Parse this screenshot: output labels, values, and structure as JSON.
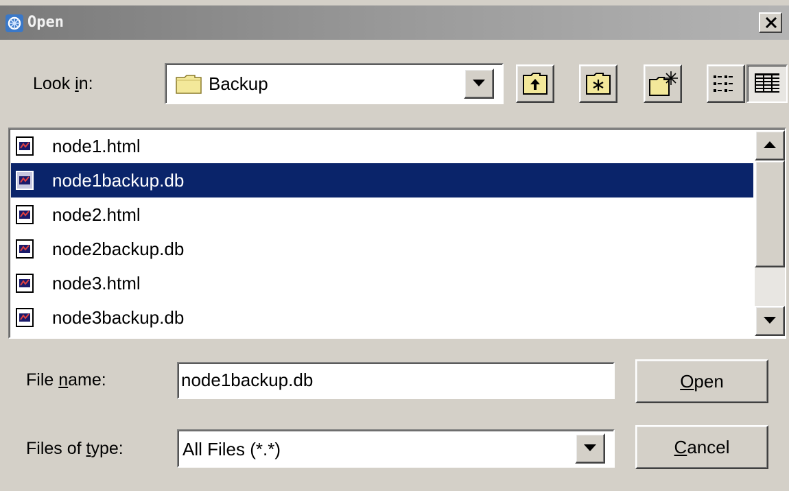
{
  "window": {
    "title": "Open"
  },
  "look_in": {
    "label_pre": "Look ",
    "label_u": "i",
    "label_post": "n:",
    "value": "Backup"
  },
  "toolbar": {
    "up_one_level": "up-folder-icon",
    "home": "home-folder-icon",
    "new_folder": "new-folder-icon",
    "list_view": "list-view-icon",
    "details_view": "details-view-icon"
  },
  "files": [
    {
      "name": "node1.html",
      "selected": false
    },
    {
      "name": "node1backup.db",
      "selected": true
    },
    {
      "name": "node2.html",
      "selected": false
    },
    {
      "name": "node2backup.db",
      "selected": false
    },
    {
      "name": "node3.html",
      "selected": false
    },
    {
      "name": "node3backup.db",
      "selected": false
    }
  ],
  "file_name": {
    "label_pre": "File ",
    "label_u": "n",
    "label_post": "ame:",
    "value": "node1backup.db"
  },
  "file_type": {
    "label_pre": "Files of ",
    "label_u": "t",
    "label_post": "ype:",
    "value": "All Files (*.*)"
  },
  "buttons": {
    "open_u": "O",
    "open_rest": "pen",
    "cancel_u": "C",
    "cancel_rest": "ancel"
  },
  "colors": {
    "dialog_bg": "#d4d0c8",
    "selection": "#0a246a",
    "folder_yellow": "#f3e89a"
  }
}
